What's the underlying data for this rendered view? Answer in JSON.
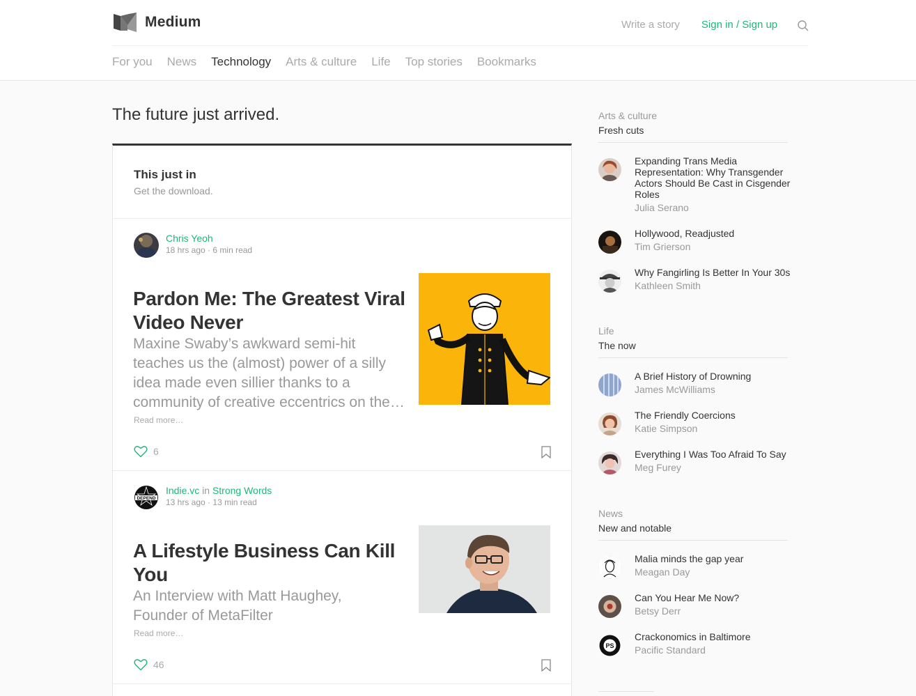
{
  "header": {
    "brand": "Medium",
    "write_label": "Write a story",
    "signin_label": "Sign in / Sign up"
  },
  "nav": [
    "For you",
    "News",
    "Technology",
    "Arts & culture",
    "Life",
    "Top stories",
    "Bookmarks"
  ],
  "nav_active": "Technology",
  "page_title": "The future just arrived.",
  "feed": {
    "section_title": "This just in",
    "section_subtitle": "Get the download.",
    "posts": [
      {
        "author": "Chris Yeoh",
        "in_label": "",
        "publication": "",
        "time": "18 hrs ago",
        "read_time": "6 min read",
        "title": "Pardon Me: The Greatest Viral Video Never",
        "subtitle": "Maxine Swaby’s awkward semi-hit teaches us the (almost) power of a silly idea made even sillier thanks to a community of creative eccentrics on the…",
        "read_more": "Read more…",
        "likes": "6"
      },
      {
        "author": "Indie.vc",
        "in_label": "in",
        "publication": "Strong Words",
        "time": "13 hrs ago",
        "read_time": "13 min read",
        "title": "A Lifestyle Business Can Kill You",
        "subtitle": "An Interview with Matt Haughey, Founder of MetaFilter",
        "read_more": "Read more…",
        "likes": "46"
      }
    ]
  },
  "sidebar": [
    {
      "category": "Arts & culture",
      "heading": "Fresh cuts",
      "items": [
        {
          "title": "Expanding Trans Media Representation: Why Transgender Actors Should Be Cast in Cisgender Roles",
          "author": "Julia Serano"
        },
        {
          "title": "Hollywood, Readjusted",
          "author": "Tim Grierson"
        },
        {
          "title": "Why Fangirling Is Better In Your 30s",
          "author": "Kathleen Smith"
        }
      ]
    },
    {
      "category": "Life",
      "heading": "The now",
      "items": [
        {
          "title": "A Brief History of Drowning",
          "author": "James McWilliams"
        },
        {
          "title": "The Friendly Coercions",
          "author": "Katie Simpson"
        },
        {
          "title": "Everything I Was Too Afraid To Say",
          "author": "Meg Furey"
        }
      ]
    },
    {
      "category": "News",
      "heading": "New and notable",
      "items": [
        {
          "title": "Malia minds the gap year",
          "author": "Meagan Day"
        },
        {
          "title": "Can You Hear Me Now?",
          "author": "Betsy Derr"
        },
        {
          "title": "Crackonomics in Baltimore",
          "author": "Pacific Standard"
        }
      ]
    }
  ],
  "colors": {
    "accent_green": "#1cb878",
    "text_dark": "#333333",
    "text_muted": "#999999",
    "image_yellow": "#fbb40a"
  },
  "icons": [
    "medium-logo-icon",
    "search-icon",
    "heart-icon",
    "bookmark-icon"
  ]
}
